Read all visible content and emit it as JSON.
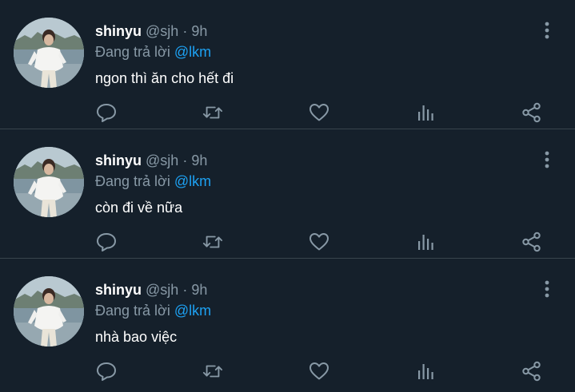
{
  "tweets": [
    {
      "name": "shinyu",
      "handle": "@sjh",
      "separator": "·",
      "time": "9h",
      "reply_prefix": "Đang trả lời",
      "reply_to": "@lkm",
      "text": "ngon thì ăn cho hết đi"
    },
    {
      "name": "shinyu",
      "handle": "@sjh",
      "separator": "·",
      "time": "9h",
      "reply_prefix": "Đang trả lời",
      "reply_to": "@lkm",
      "text": "còn đi về nữa"
    },
    {
      "name": "shinyu",
      "handle": "@sjh",
      "separator": "·",
      "time": "9h",
      "reply_prefix": "Đang trả lời",
      "reply_to": "@lkm",
      "text": "nhà bao việc"
    }
  ],
  "icons": {
    "more": "more-vertical-icon",
    "reply": "comment-bubble-icon",
    "retweet": "retweet-icon",
    "like": "heart-icon",
    "stats": "bar-chart-icon",
    "share": "share-nodes-icon"
  },
  "colors": {
    "background": "#15202b",
    "divider": "#38444d",
    "secondary_text": "#8899a6",
    "mention": "#1da1f2",
    "icon": "#8899a6"
  }
}
